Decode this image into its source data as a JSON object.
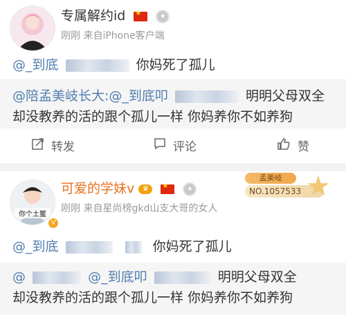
{
  "post1": {
    "username": "专属解约id",
    "meta": "刚刚  来自iPhone客户端",
    "content_prefix": "@_到底",
    "content_suffix": "你妈死了孤儿",
    "repost_line1_prefix": "@陪孟美岐长大:@_到底叩",
    "repost_line1_suffix": "明明父母双全",
    "repost_line2": "却没教养的活的跟个孤儿一样 你妈养你不如养狗",
    "actions": {
      "repost": "转发",
      "comment": "评论",
      "like": "赞"
    }
  },
  "post2": {
    "username": "可爱的学妹v",
    "avatar_label": "你个土鳖",
    "meta": "刚刚  来自星尚榜gkd山支大哥的女人",
    "fan_badge_title": "孟美岐",
    "fan_badge_number": "NO.1057533",
    "content_prefix": "@_到底",
    "content_suffix": "你妈死了孤儿",
    "repost_line1_prefix": "@",
    "repost_line1_mid": "@_到底叩",
    "repost_line1_suffix": "明明父母双全",
    "repost_line2": "却没教养的活的跟个孤儿一样 你妈养你不如养狗"
  },
  "icons": [
    "repost-icon",
    "comment-icon",
    "like-icon",
    "china-flag-icon",
    "medal-icon",
    "crown-icon",
    "verified-badge-icon",
    "star-icon"
  ],
  "colors": {
    "link": "#507daf",
    "vip_name": "#e8711c",
    "repost_bg": "#f5f5f5"
  }
}
